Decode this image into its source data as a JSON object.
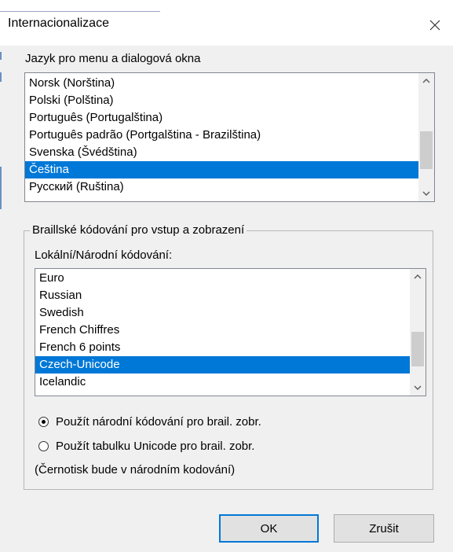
{
  "window": {
    "title": "Internacionalizace"
  },
  "language_section": {
    "label": "Jazyk pro menu a dialogová okna",
    "items": [
      "Norsk (Norština)",
      "Polski (Polština)",
      "Português (Portugalština)",
      "Português padrão (Portgalština - Brazilština)",
      "Svenska (Švédština)",
      "Čeština",
      "Русский (Ruština)"
    ],
    "selected_index": 5
  },
  "braille_group": {
    "legend": "Braillské kódování pro vstup a zobrazení",
    "encoding_label": "Lokální/Národní kódování:",
    "encodings": [
      "Euro",
      "Russian",
      "Swedish",
      "French Chiffres",
      "French 6 points",
      "Czech-Unicode",
      "Icelandic"
    ],
    "selected_index": 5,
    "radios": [
      {
        "label": "Použít národní kódování pro brail. zobr.",
        "checked": true
      },
      {
        "label": "Použít tabulku Unicode pro brail. zobr.",
        "checked": false
      }
    ],
    "note": "(Černotisk bude v národním kodování)"
  },
  "buttons": {
    "ok": "OK",
    "cancel": "Zrušit"
  },
  "colors": {
    "selection": "#0078d7",
    "dialog_bg": "#f0f0f0",
    "default_button_border": "#0078d7"
  },
  "icons": {
    "close": "close-icon",
    "scroll_up": "chevron-up-icon",
    "scroll_down": "chevron-down-icon"
  }
}
